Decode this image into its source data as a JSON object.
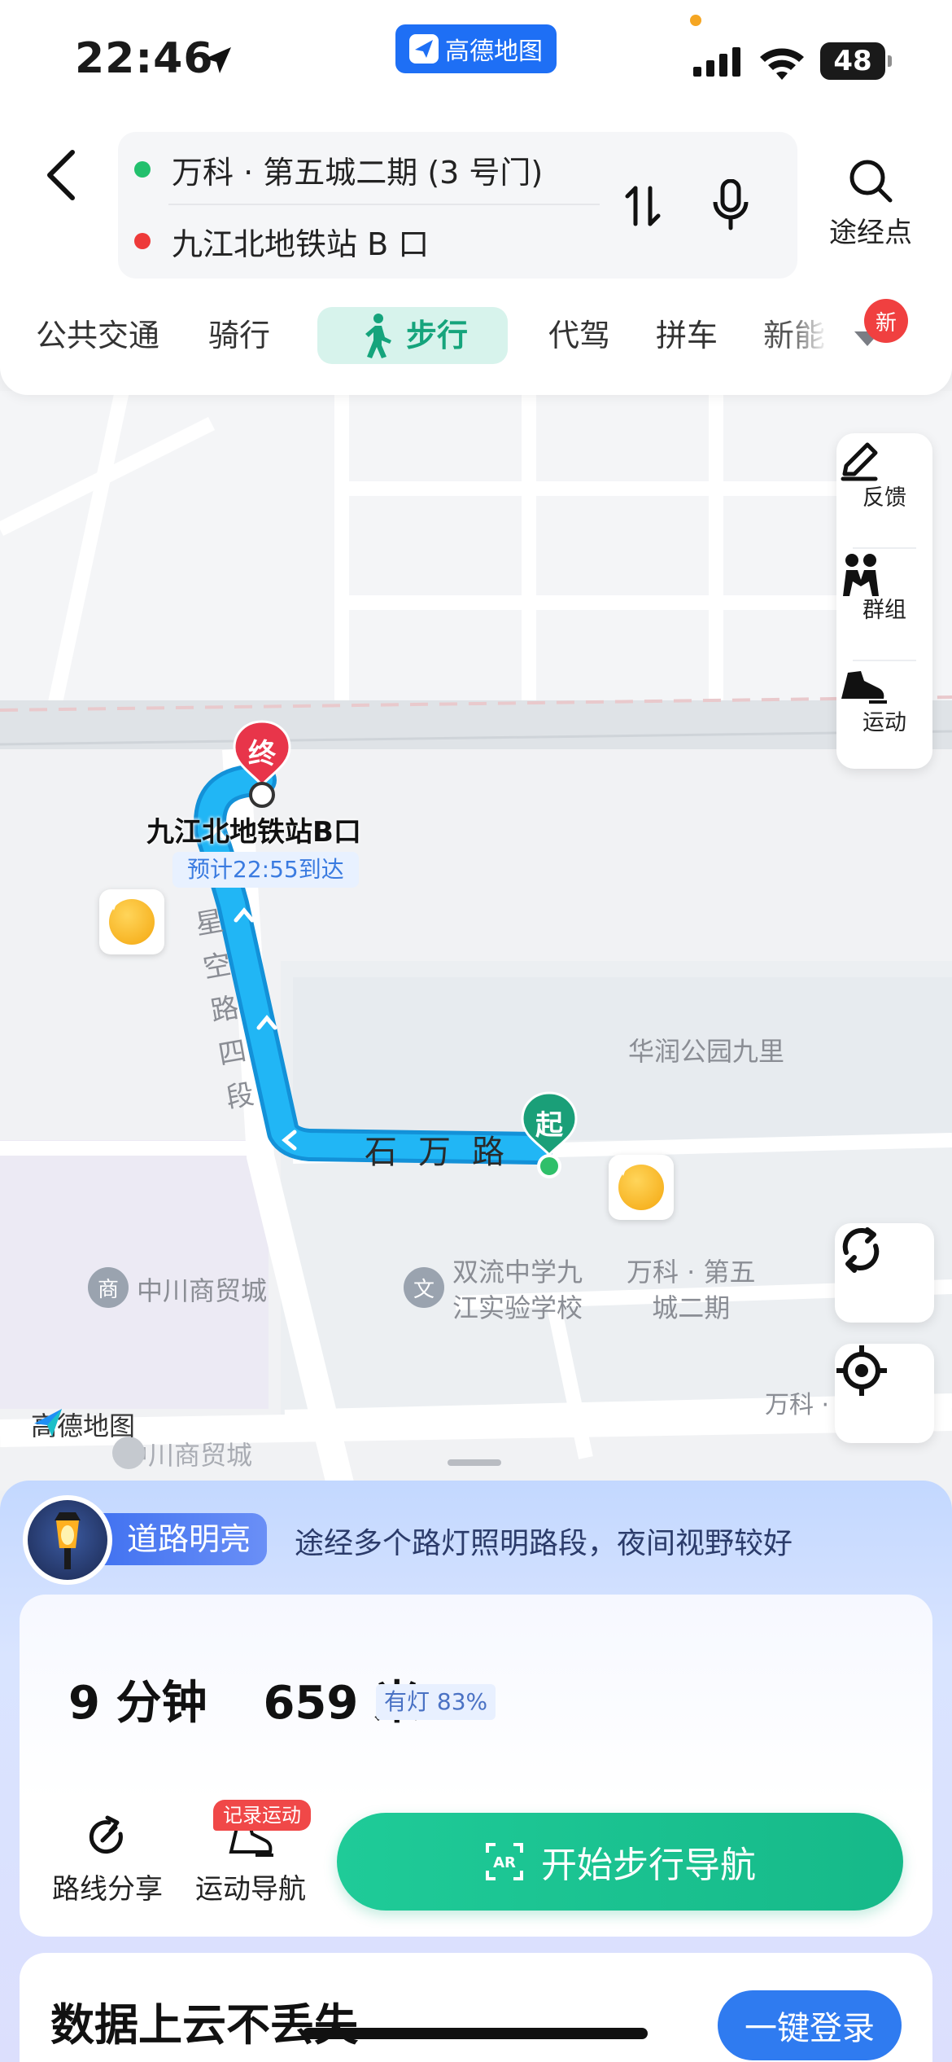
{
  "status_bar": {
    "time": "22:46",
    "battery": "48"
  },
  "app_pill": {
    "label": "高德地图"
  },
  "route": {
    "origin": "万科 · 第五城二期 (3 号门)",
    "destination": "九江北地铁站 B 口",
    "waypoint_label": "途经点"
  },
  "tabs": [
    {
      "label": "公共交通"
    },
    {
      "label": "骑行"
    },
    {
      "label": "步行"
    },
    {
      "label": "代驾"
    },
    {
      "label": "拼车"
    },
    {
      "label": "新能"
    }
  ],
  "new_badge": "新",
  "side_tools": {
    "feedback": "反馈",
    "group": "群组",
    "sport": "运动"
  },
  "map": {
    "end_pin": "终",
    "start_pin": "起",
    "dest_label": "九江北地铁站B口",
    "eta": "预计22:55到达",
    "road_vertical": [
      "星",
      "空",
      "路",
      "四",
      "段"
    ],
    "road_horizontal": [
      "石",
      "万",
      "路"
    ],
    "poi_park": "华润公园九里",
    "poi_mall": "中川商贸城",
    "poi_school_line1": "双流中学九",
    "poi_school_line2": "江实验学校",
    "poi_wanke_line1": "万科 · 第五",
    "poi_wanke_line2": "城二期",
    "poi_wanke_small": "万科 ·",
    "poi_mall_bottom": "中川商贸城",
    "watermark": "高德地图",
    "mall_icon": "商",
    "school_icon": "文"
  },
  "lighting": {
    "tag": "道路明亮",
    "description": "途经多个路灯照明路段，夜间视野较好"
  },
  "summary": {
    "duration": "9 分钟",
    "distance": "659 米",
    "light_ratio": "有灯 83%"
  },
  "actions": {
    "share": "路线分享",
    "sport_nav": "运动导航",
    "record_badge": "记录运动",
    "start_button": "开始步行导航"
  },
  "login": {
    "title": "数据上云不丢失",
    "button": "一键登录"
  },
  "colors": {
    "route_blue": "#21b6f5",
    "accent_green": "#1fc596",
    "brand_blue": "#1e6ff5",
    "pin_red": "#e8354a"
  }
}
